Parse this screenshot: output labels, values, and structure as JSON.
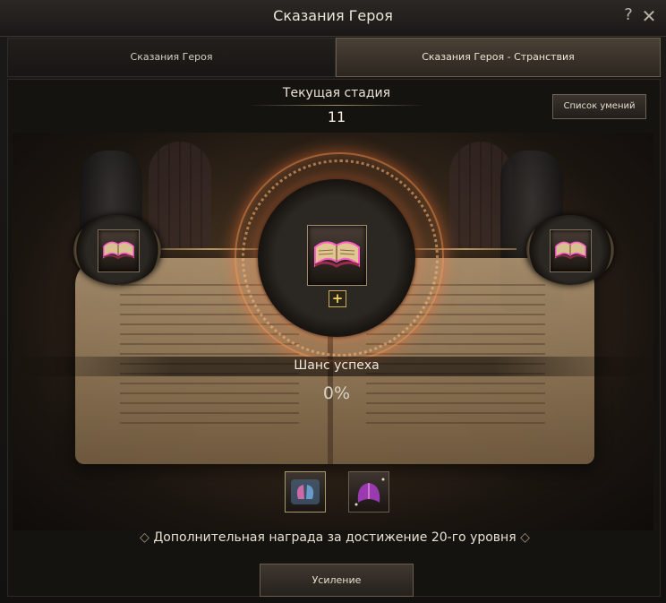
{
  "window": {
    "title": "Сказания Героя",
    "help_icon": "?",
    "close_icon": "✕"
  },
  "tabs": [
    {
      "label": "Сказания Героя",
      "active": false
    },
    {
      "label": "Сказания Героя - Странствия",
      "active": true
    }
  ],
  "stage": {
    "label": "Текущая стадия",
    "value": "11"
  },
  "skills_button": "Список умений",
  "slots": {
    "left": {
      "icon": "book-icon"
    },
    "center": {
      "icon": "book-icon"
    },
    "right": {
      "icon": "book-icon"
    },
    "add": "+"
  },
  "chance": {
    "label": "Шанс успеха",
    "value": "0%"
  },
  "materials": [
    {
      "icon": "lung-scroll-icon"
    },
    {
      "icon": "wing-crystal-icon"
    }
  ],
  "reward": {
    "prefix": "◇",
    "text": "Дополнительная награда за достижение 20-го уровня",
    "suffix": "◇"
  },
  "upgrade_button": "Усиление",
  "colors": {
    "accent_gold": "#c8a070",
    "glow": "#ff8a4a",
    "tab_active": "#4a4136"
  }
}
